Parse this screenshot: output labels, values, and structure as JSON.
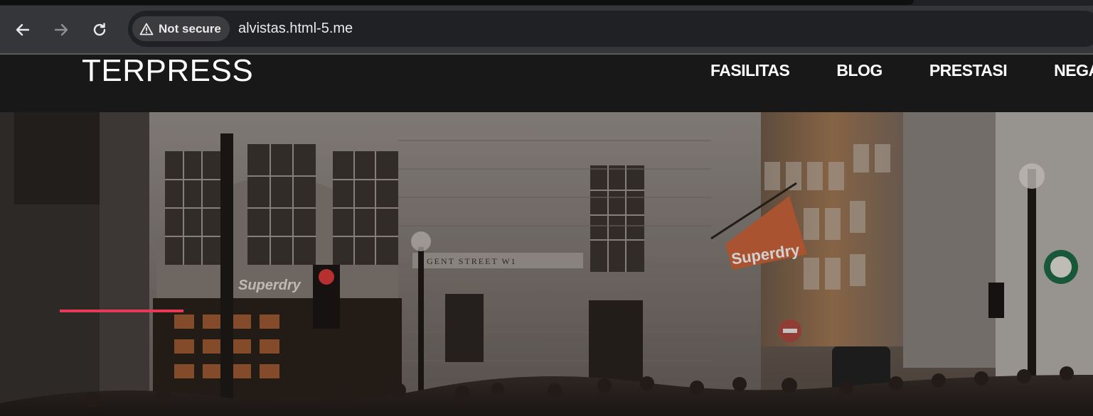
{
  "browser": {
    "security_label": "Not secure",
    "url": "alvistas.html-5.me",
    "icons": [
      "back-arrow-icon",
      "forward-arrow-icon",
      "reload-icon",
      "warning-triangle-icon"
    ]
  },
  "site": {
    "logo": "TERPRESS",
    "nav": [
      {
        "label": "FASILITAS"
      },
      {
        "label": "BLOG"
      },
      {
        "label": "PRESTASI"
      },
      {
        "label": "NEGARA"
      }
    ]
  },
  "hero": {
    "image_signs": [
      "Superdry",
      "Superdry",
      "GENT STREET W1"
    ],
    "accent_color": "#e63a57"
  },
  "colors": {
    "chrome_toolbar": "#35363a",
    "omnibox": "#202124",
    "site_header": "#181818",
    "accent": "#e63a57"
  }
}
